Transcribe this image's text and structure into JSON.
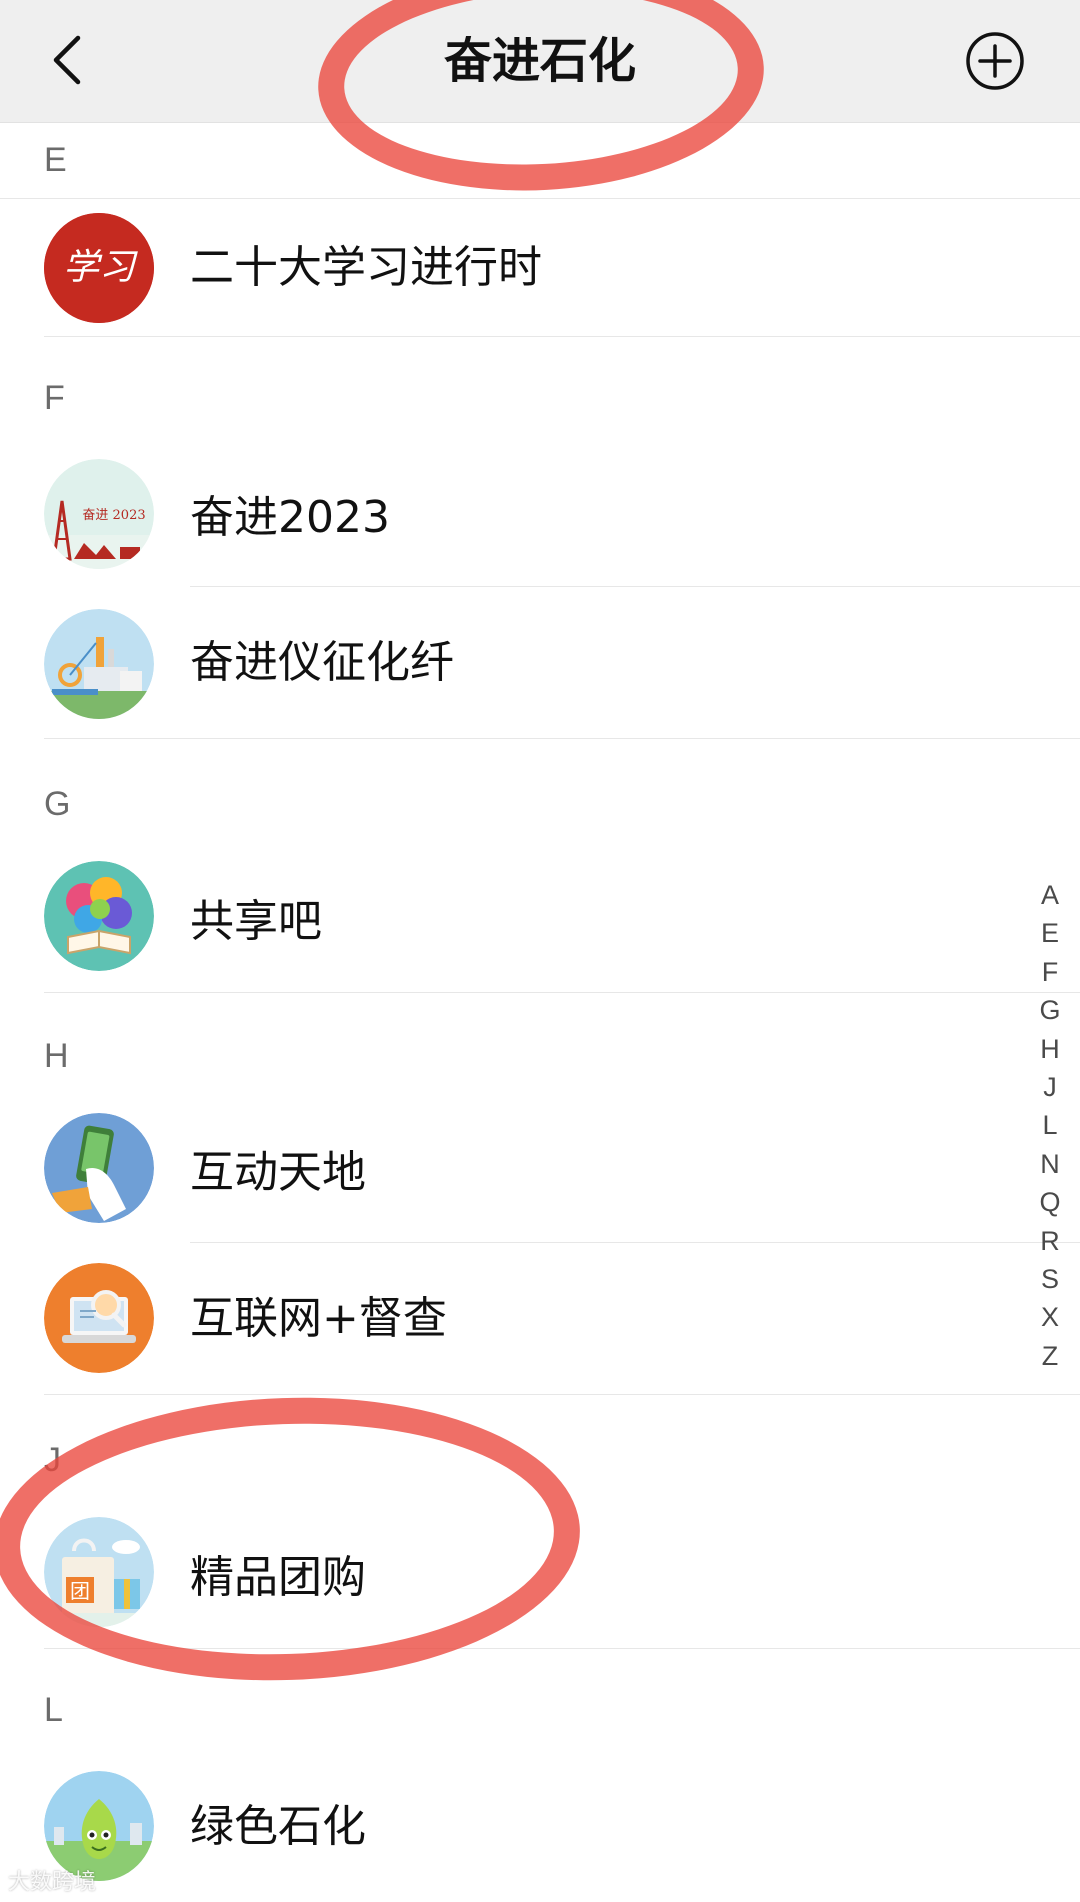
{
  "header": {
    "title": "奋进石化",
    "back_icon": "chevron-left-icon",
    "add_icon": "plus-circle-icon"
  },
  "sections": [
    {
      "letter": "E",
      "items": [
        {
          "label": "二十大学习进行时",
          "avatar": "study-logo"
        }
      ]
    },
    {
      "letter": "F",
      "items": [
        {
          "label": "奋进2023",
          "avatar": "oil-derrick"
        },
        {
          "label": "奋进仪征化纤",
          "avatar": "factory"
        }
      ]
    },
    {
      "letter": "G",
      "items": [
        {
          "label": "共享吧",
          "avatar": "colorful-book"
        }
      ]
    },
    {
      "letter": "H",
      "items": [
        {
          "label": "互动天地",
          "avatar": "phone-hand"
        },
        {
          "label": "互联网+督查",
          "avatar": "laptop-magnifier"
        }
      ]
    },
    {
      "letter": "J",
      "items": [
        {
          "label": "精品团购",
          "avatar": "group-buy-bag"
        }
      ]
    },
    {
      "letter": "L",
      "items": [
        {
          "label": "绿色石化",
          "avatar": "green-mascot"
        }
      ]
    }
  ],
  "index_bar": [
    "A",
    "E",
    "F",
    "G",
    "H",
    "J",
    "L",
    "N",
    "Q",
    "R",
    "S",
    "X",
    "Z"
  ],
  "avatar_text": {
    "study": "学习",
    "derrick": "奋进 2023",
    "group_buy": "团"
  },
  "watermark": "大数跨境",
  "colors": {
    "header_bg": "#efefef",
    "annotation_ring": "#eb463c",
    "section_letter": "#6b6b6b"
  }
}
